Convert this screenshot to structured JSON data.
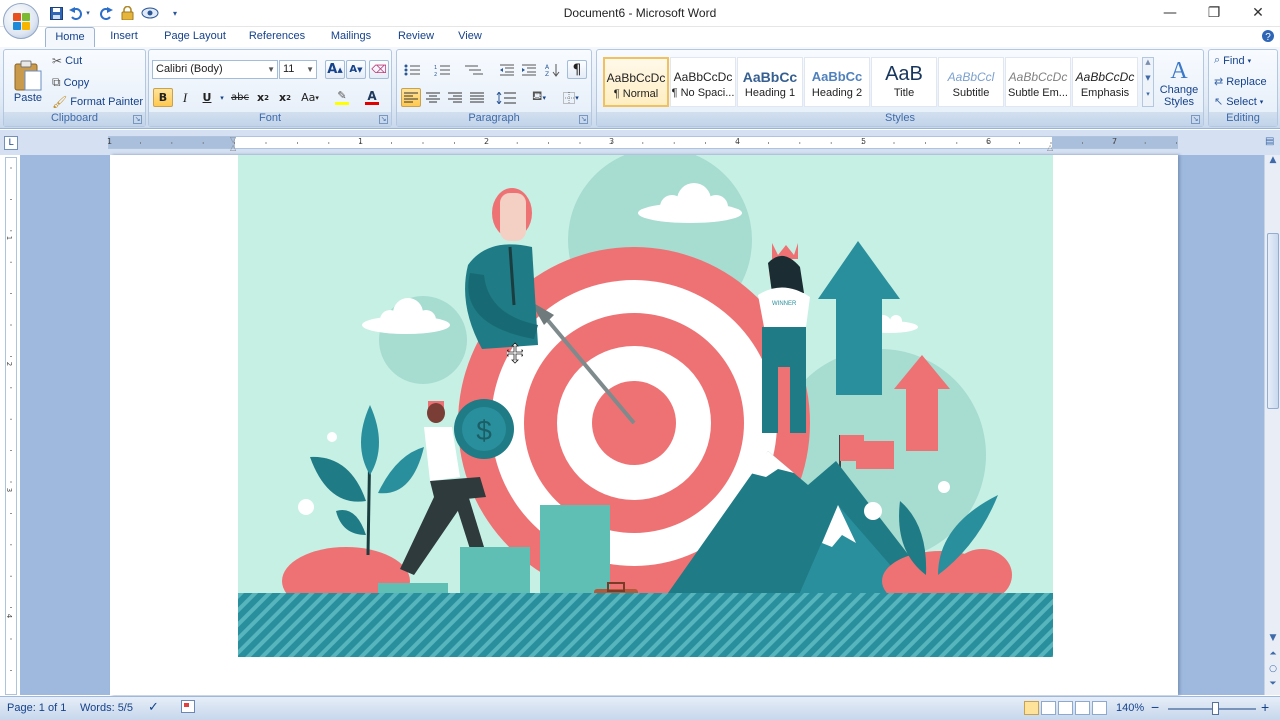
{
  "app": {
    "title": "Document6 - Microsoft Word",
    "window_controls": [
      "—",
      "❐",
      "✕"
    ]
  },
  "qat": [
    "save-icon",
    "undo-icon",
    "redo-icon",
    "lock-icon",
    "preview-icon",
    "customize-icon"
  ],
  "tabs": [
    {
      "label": "Home",
      "active": true
    },
    {
      "label": "Insert"
    },
    {
      "label": "Page Layout"
    },
    {
      "label": "References"
    },
    {
      "label": "Mailings"
    },
    {
      "label": "Review"
    },
    {
      "label": "View"
    }
  ],
  "clipboard": {
    "group_label": "Clipboard",
    "paste": "Paste",
    "cut": "Cut",
    "copy": "Copy",
    "format_painter": "Format Painter"
  },
  "font": {
    "group_label": "Font",
    "family": "Calibri (Body)",
    "size": "11",
    "grow": "A",
    "shrink": "A",
    "bold": "B",
    "italic": "I",
    "underline": "U",
    "strike": "abc",
    "subscript": "x",
    "superscript": "x",
    "change_case": "Aa",
    "font_color_glyph": "A",
    "highlight_color": "#ffff00",
    "font_color": "#e00000"
  },
  "paragraph": {
    "group_label": "Paragraph",
    "pilcrow": "¶"
  },
  "styles": {
    "group_label": "Styles",
    "items": [
      {
        "sample": "AaBbCcDc",
        "name": "¶ Normal",
        "selected": true
      },
      {
        "sample": "AaBbCcDc",
        "name": "¶ No Spaci..."
      },
      {
        "sample": "AaBbCc",
        "name": "Heading 1"
      },
      {
        "sample": "AaBbCc",
        "name": "Heading 2"
      },
      {
        "sample": "AaB",
        "name": "Title"
      },
      {
        "sample": "AaBbCcl",
        "name": "Subtitle"
      },
      {
        "sample": "AaBbCcDc",
        "name": "Subtle Em..."
      },
      {
        "sample": "AaBbCcDc",
        "name": "Emphasis"
      }
    ],
    "change_styles": "Change Styles",
    "change_styles_glyph": "A"
  },
  "editing": {
    "group_label": "Editing",
    "find": "Find",
    "replace": "Replace",
    "select": "Select"
  },
  "ruler": {
    "tab_selector": "L",
    "numbers": [
      "1",
      "1",
      "2",
      "3",
      "4",
      "5",
      "6",
      "7"
    ],
    "vnumbers": [
      "1",
      "2",
      "3",
      "4"
    ]
  },
  "document": {
    "image_badge": "WINNER"
  },
  "status": {
    "page": "Page: 1 of 1",
    "words": "Words: 5/5",
    "zoom": "140%",
    "zoom_minus": "−",
    "zoom_plus": "+"
  }
}
